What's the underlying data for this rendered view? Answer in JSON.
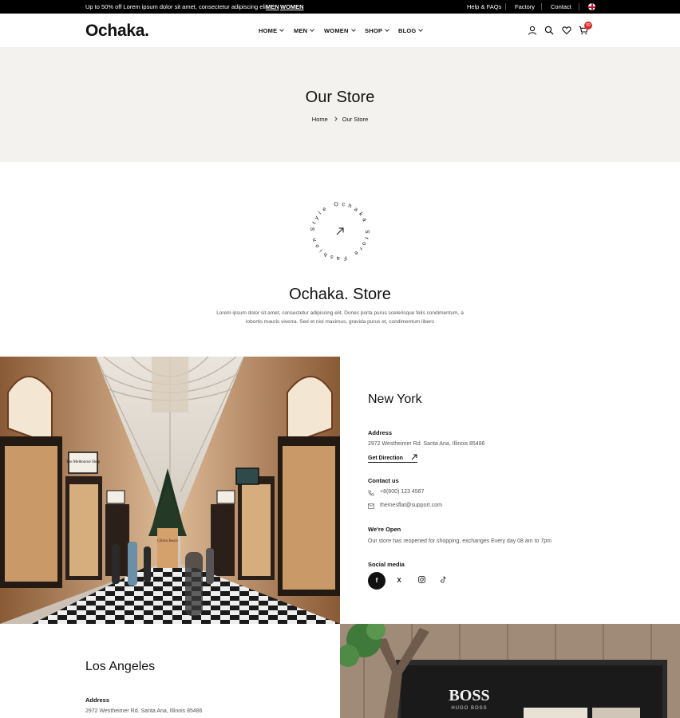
{
  "topbar": {
    "promo": "Up to 50% off Lorem ipsum dolor sit amet, consectetur adipiscing elit",
    "links_promo": [
      "MEN",
      "WOMEN"
    ],
    "links_right": [
      "Help & FAQs",
      "Factory",
      "Contact"
    ]
  },
  "header": {
    "logo": "Ochaka.",
    "nav": [
      "HOME",
      "MEN",
      "WOMEN",
      "SHOP",
      "BLOG"
    ],
    "cart_count": "99",
    "icons": [
      "user-icon",
      "search-icon",
      "heart-icon",
      "cart-icon"
    ]
  },
  "page": {
    "title": "Our Store",
    "breadcrumb": [
      "Home",
      "Our Store"
    ]
  },
  "intro": {
    "badge_text": "Style Ochaka Store Fashion",
    "heading": "Ochaka. Store",
    "text": "Lorem ipsum dolor sit amet, consectetur adipiscing elit. Donec porta purus scelerisque felis condimentum, a lobortis mauris viverra. Sed et nisl maximus, gravida purus et, condimentum libero"
  },
  "stores": [
    {
      "city": "New York",
      "address_label": "Address",
      "address": "2972 Westheimer Rd. Santa Ana, Illinois 85486",
      "direction": "Get Direction",
      "contact_label": "Contact us",
      "phone": "+8(800) 123 4567",
      "email": "themesflat@support.com",
      "open_label": "We're Open",
      "open_text": "Our store has reopened for shopping, exchanges Every day 08 am to 7pm",
      "social_label": "Social media",
      "social": [
        "f",
        "X",
        "IG",
        "TT"
      ]
    },
    {
      "city": "Los Angeles",
      "address_label": "Address",
      "address": "2972 Westheimer Rd. Santa Ana, Illinois 85486"
    }
  ],
  "photos": {
    "boss_sign": "BOSS",
    "boss_sub": "HUGO BOSS",
    "sign_left": "The Melbourne Shop",
    "sign_box": "Gloria Jean's"
  },
  "colors": {
    "accent": "#d62b2b",
    "band": "#f3f2ef",
    "dark": "#000000"
  }
}
